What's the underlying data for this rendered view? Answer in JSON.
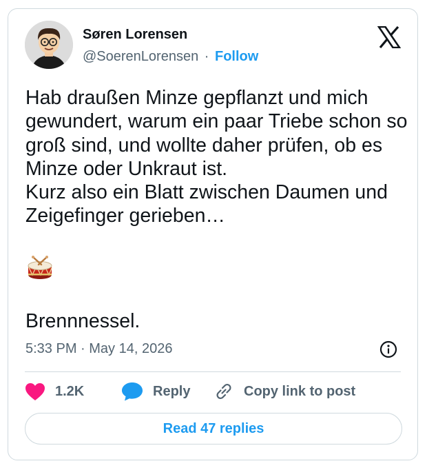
{
  "author": {
    "display_name": "Søren Lorensen",
    "handle": "@SoerenLorensen",
    "separator": "·",
    "follow_label": "Follow"
  },
  "icons": {
    "brand": "x-logo-icon",
    "info": "info-icon",
    "like": "heart-icon",
    "reply": "speech-bubble-icon",
    "copy": "link-icon",
    "emoji": "drum-emoji"
  },
  "tweet": {
    "text": "Hab draußen Minze gepflanzt und mich gewundert, warum ein paar Triebe schon so groß sind, und wollte daher prüfen, ob es Minze oder Unkraut ist.\nKurz also ein Blatt zwischen Daumen und Zeigefinger gerieben…",
    "closing": "Brennnessel.",
    "timestamp": "5:33 PM · May 14, 2026"
  },
  "actions": {
    "likes": "1.2K",
    "reply_label": "Reply",
    "copy_label": "Copy link to post"
  },
  "footer": {
    "read_replies_label": "Read 47 replies"
  },
  "colors": {
    "accent": "#1d9bf0",
    "like": "#f91880",
    "muted": "#536471",
    "text": "#0f1419",
    "border": "#cfd9de"
  }
}
